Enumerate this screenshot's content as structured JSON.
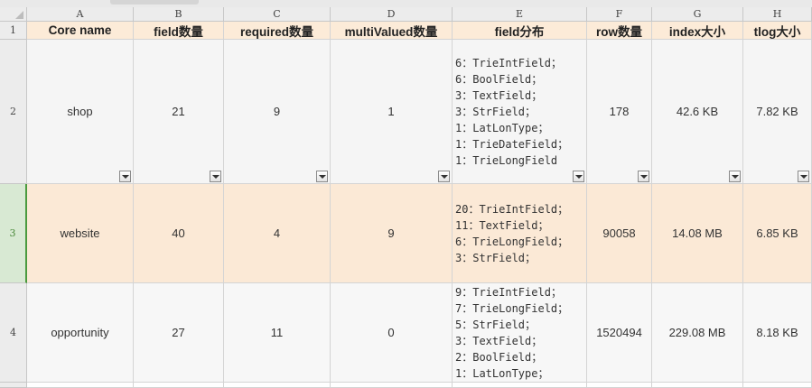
{
  "columns": [
    "A",
    "B",
    "C",
    "D",
    "E",
    "F",
    "G",
    "H"
  ],
  "row_numbers": [
    "1",
    "2",
    "3",
    "4"
  ],
  "header": {
    "core_name": "Core name",
    "field_count": "field数量",
    "required_count": "required数量",
    "multivalued_count": "multiValued数量",
    "field_distribution": "field分布",
    "row_count": "row数量",
    "index_size": "index大小",
    "tlog_size": "tlog大小"
  },
  "rows": [
    {
      "core_name": "shop",
      "field_count": "21",
      "required_count": "9",
      "multivalued_count": "1",
      "field_distribution": [
        "6：TrieIntField；",
        "6：BoolField；",
        "3：TextField；",
        "3：StrField；",
        "1：LatLonType；",
        "1：TrieDateField；",
        "1：TrieLongField"
      ],
      "row_count": "178",
      "index_size": "42.6 KB",
      "tlog_size": "7.82 KB"
    },
    {
      "core_name": "website",
      "field_count": "40",
      "required_count": "4",
      "multivalued_count": "9",
      "field_distribution": [
        "20：TrieIntField；",
        "11：TextField；",
        "6：TrieLongField；",
        "3：StrField；"
      ],
      "row_count": "90058",
      "index_size": "14.08 MB",
      "tlog_size": "6.85 KB"
    },
    {
      "core_name": "opportunity",
      "field_count": "27",
      "required_count": "11",
      "multivalued_count": "0",
      "field_distribution": [
        "9：TrieIntField；",
        "7：TrieLongField；",
        "5：StrField；",
        "3：TextField；",
        "2：BoolField；",
        "1：LatLonType；"
      ],
      "row_count": "1520494",
      "index_size": "229.08 MB",
      "tlog_size": "8.18 KB"
    }
  ],
  "colors": {
    "header_fill": "#fcebd8",
    "selected_row_fill": "#fbe9d6",
    "active_row_marker": "#4a9a3e"
  }
}
